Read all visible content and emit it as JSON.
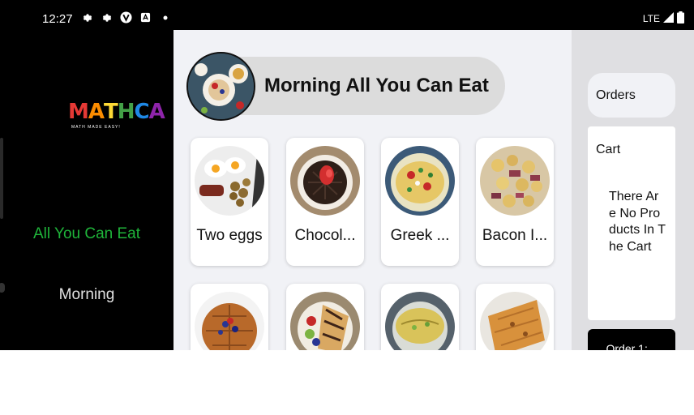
{
  "status_bar": {
    "time": "12:27",
    "network": "LTE",
    "icons": [
      "settings-icon",
      "settings-icon",
      "vpn-icon",
      "notification-icon",
      "dot-icon"
    ]
  },
  "sidebar": {
    "logo_text": "MATHCA",
    "logo_tagline": "MATH MADE EASY!",
    "logo_colors": [
      "#e53935",
      "#fb8c00",
      "#fdd835",
      "#43a047",
      "#1e88e5",
      "#8e24aa"
    ],
    "nav": [
      {
        "label": "All You Can Eat",
        "active": true,
        "color": "#1fb53a"
      },
      {
        "label": "Morning",
        "active": false,
        "color": "#e0e0e0"
      }
    ]
  },
  "main": {
    "title": "Morning All You Can Eat",
    "products": [
      {
        "name": "Two eggs",
        "image": "eggs-bacon-image"
      },
      {
        "name": "Chocol...",
        "image": "chocolate-waffle-image"
      },
      {
        "name": "Greek ...",
        "image": "greek-omelette-image"
      },
      {
        "name": "Bacon I...",
        "image": "bacon-potatoes-image"
      },
      {
        "name": "",
        "image": "berry-waffle-image"
      },
      {
        "name": "",
        "image": "crepe-image"
      },
      {
        "name": "",
        "image": "omelette-image"
      },
      {
        "name": "",
        "image": "quesadilla-image"
      }
    ]
  },
  "right_panel": {
    "orders_label": "Orders",
    "cart_title": "Cart",
    "cart_empty_text": "There Are No Products In The Cart",
    "order_button_label": "Order 1:..."
  },
  "colors": {
    "accent_green": "#1fb53a",
    "main_bg": "#f1f2f6",
    "panel_bg": "#dfdfe2",
    "pill_bg": "#dcdcdc"
  }
}
